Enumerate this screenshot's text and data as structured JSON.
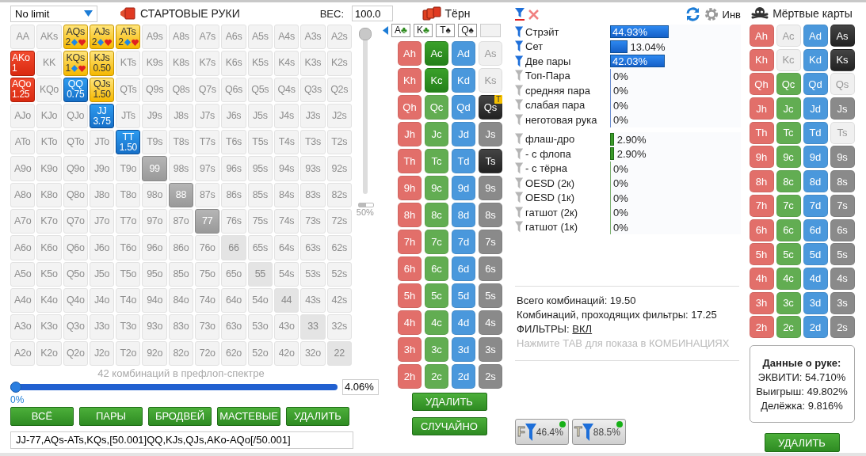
{
  "range_panel": {
    "game_dropdown": "No limit",
    "title": "СТАРТОВЫЕ РУКИ",
    "weight_label": "ВЕС:",
    "weight_value": "100.0",
    "grid": [
      [
        {
          "label": "AA",
          "kind": "none"
        },
        {
          "label": "AKs",
          "kind": "none"
        },
        {
          "label": "AQs",
          "kind": "gold-mixed",
          "weight": "2"
        },
        {
          "label": "AJs",
          "kind": "gold-mixed",
          "weight": "2"
        },
        {
          "label": "ATs",
          "kind": "gold-mixed",
          "weight": "2"
        },
        {
          "label": "A9s",
          "kind": "none"
        },
        {
          "label": "A8s",
          "kind": "none"
        },
        {
          "label": "A7s",
          "kind": "none"
        },
        {
          "label": "A6s",
          "kind": "none"
        },
        {
          "label": "A5s",
          "kind": "none"
        },
        {
          "label": "A4s",
          "kind": "none"
        },
        {
          "label": "A3s",
          "kind": "none"
        },
        {
          "label": "A2s",
          "kind": "none"
        }
      ],
      [
        {
          "label": "AKo",
          "kind": "red",
          "weight": "1"
        },
        {
          "label": "KK",
          "kind": "none"
        },
        {
          "label": "KQs",
          "kind": "gold-mixed",
          "weight": "1"
        },
        {
          "label": "KJs",
          "kind": "gold",
          "weight": "0.50"
        },
        {
          "label": "KTs",
          "kind": "none"
        },
        {
          "label": "K9s",
          "kind": "none"
        },
        {
          "label": "K8s",
          "kind": "none"
        },
        {
          "label": "K7s",
          "kind": "none"
        },
        {
          "label": "K6s",
          "kind": "none"
        },
        {
          "label": "K5s",
          "kind": "none"
        },
        {
          "label": "K4s",
          "kind": "none"
        },
        {
          "label": "K3s",
          "kind": "none"
        },
        {
          "label": "K2s",
          "kind": "none"
        }
      ],
      [
        {
          "label": "AQo",
          "kind": "red",
          "weight": "1.25"
        },
        {
          "label": "KQo",
          "kind": "none"
        },
        {
          "label": "QQ",
          "kind": "blue",
          "weight": "0.75"
        },
        {
          "label": "QJs",
          "kind": "gold",
          "weight": "1.50"
        },
        {
          "label": "QTs",
          "kind": "none"
        },
        {
          "label": "Q9s",
          "kind": "none"
        },
        {
          "label": "Q8s",
          "kind": "none"
        },
        {
          "label": "Q7s",
          "kind": "none"
        },
        {
          "label": "Q6s",
          "kind": "none"
        },
        {
          "label": "Q5s",
          "kind": "none"
        },
        {
          "label": "Q4s",
          "kind": "none"
        },
        {
          "label": "Q3s",
          "kind": "none"
        },
        {
          "label": "Q2s",
          "kind": "none"
        }
      ],
      [
        {
          "label": "AJo",
          "kind": "none"
        },
        {
          "label": "KJo",
          "kind": "none"
        },
        {
          "label": "QJo",
          "kind": "none"
        },
        {
          "label": "JJ",
          "kind": "blue",
          "weight": "3.75"
        },
        {
          "label": "JTs",
          "kind": "none"
        },
        {
          "label": "J9s",
          "kind": "none"
        },
        {
          "label": "J8s",
          "kind": "none"
        },
        {
          "label": "J7s",
          "kind": "none"
        },
        {
          "label": "J6s",
          "kind": "none"
        },
        {
          "label": "J5s",
          "kind": "none"
        },
        {
          "label": "J4s",
          "kind": "none"
        },
        {
          "label": "J3s",
          "kind": "none"
        },
        {
          "label": "J2s",
          "kind": "none"
        }
      ],
      [
        {
          "label": "ATo",
          "kind": "none"
        },
        {
          "label": "KTo",
          "kind": "none"
        },
        {
          "label": "QTo",
          "kind": "none"
        },
        {
          "label": "JTo",
          "kind": "none"
        },
        {
          "label": "TT",
          "kind": "blue",
          "weight": "1.50"
        },
        {
          "label": "T9s",
          "kind": "none"
        },
        {
          "label": "T8s",
          "kind": "none"
        },
        {
          "label": "T7s",
          "kind": "none"
        },
        {
          "label": "T6s",
          "kind": "none"
        },
        {
          "label": "T5s",
          "kind": "none"
        },
        {
          "label": "T4s",
          "kind": "none"
        },
        {
          "label": "T3s",
          "kind": "none"
        },
        {
          "label": "T2s",
          "kind": "none"
        }
      ],
      [
        {
          "label": "A9o",
          "kind": "none"
        },
        {
          "label": "K9o",
          "kind": "none"
        },
        {
          "label": "Q9o",
          "kind": "none"
        },
        {
          "label": "J9o",
          "kind": "none"
        },
        {
          "label": "T9o",
          "kind": "none"
        },
        {
          "label": "99",
          "kind": "dead"
        },
        {
          "label": "98s",
          "kind": "none"
        },
        {
          "label": "97s",
          "kind": "none"
        },
        {
          "label": "96s",
          "kind": "none"
        },
        {
          "label": "95s",
          "kind": "none"
        },
        {
          "label": "94s",
          "kind": "none"
        },
        {
          "label": "93s",
          "kind": "none"
        },
        {
          "label": "92s",
          "kind": "none"
        }
      ],
      [
        {
          "label": "A8o",
          "kind": "none"
        },
        {
          "label": "K8o",
          "kind": "none"
        },
        {
          "label": "Q8o",
          "kind": "none"
        },
        {
          "label": "J8o",
          "kind": "none"
        },
        {
          "label": "T8o",
          "kind": "none"
        },
        {
          "label": "98o",
          "kind": "none"
        },
        {
          "label": "88",
          "kind": "dead"
        },
        {
          "label": "87s",
          "kind": "none"
        },
        {
          "label": "86s",
          "kind": "none"
        },
        {
          "label": "85s",
          "kind": "none"
        },
        {
          "label": "84s",
          "kind": "none"
        },
        {
          "label": "83s",
          "kind": "none"
        },
        {
          "label": "82s",
          "kind": "none"
        }
      ],
      [
        {
          "label": "A7o",
          "kind": "none"
        },
        {
          "label": "K7o",
          "kind": "none"
        },
        {
          "label": "Q7o",
          "kind": "none"
        },
        {
          "label": "J7o",
          "kind": "none"
        },
        {
          "label": "T7o",
          "kind": "none"
        },
        {
          "label": "97o",
          "kind": "none"
        },
        {
          "label": "87o",
          "kind": "none"
        },
        {
          "label": "77",
          "kind": "dead"
        },
        {
          "label": "76s",
          "kind": "none"
        },
        {
          "label": "75s",
          "kind": "none"
        },
        {
          "label": "74s",
          "kind": "none"
        },
        {
          "label": "73s",
          "kind": "none"
        },
        {
          "label": "72s",
          "kind": "none"
        }
      ],
      [
        {
          "label": "A6o",
          "kind": "none"
        },
        {
          "label": "K6o",
          "kind": "none"
        },
        {
          "label": "Q6o",
          "kind": "none"
        },
        {
          "label": "J6o",
          "kind": "none"
        },
        {
          "label": "T6o",
          "kind": "none"
        },
        {
          "label": "96o",
          "kind": "none"
        },
        {
          "label": "86o",
          "kind": "none"
        },
        {
          "label": "76o",
          "kind": "none"
        },
        {
          "label": "66",
          "kind": "pair"
        },
        {
          "label": "65s",
          "kind": "none"
        },
        {
          "label": "64s",
          "kind": "none"
        },
        {
          "label": "63s",
          "kind": "none"
        },
        {
          "label": "62s",
          "kind": "none"
        }
      ],
      [
        {
          "label": "A5o",
          "kind": "none"
        },
        {
          "label": "K5o",
          "kind": "none"
        },
        {
          "label": "Q5o",
          "kind": "none"
        },
        {
          "label": "J5o",
          "kind": "none"
        },
        {
          "label": "T5o",
          "kind": "none"
        },
        {
          "label": "95o",
          "kind": "none"
        },
        {
          "label": "85o",
          "kind": "none"
        },
        {
          "label": "75o",
          "kind": "none"
        },
        {
          "label": "65o",
          "kind": "none"
        },
        {
          "label": "55",
          "kind": "pair"
        },
        {
          "label": "54s",
          "kind": "none"
        },
        {
          "label": "53s",
          "kind": "none"
        },
        {
          "label": "52s",
          "kind": "none"
        }
      ],
      [
        {
          "label": "A4o",
          "kind": "none"
        },
        {
          "label": "K4o",
          "kind": "none"
        },
        {
          "label": "Q4o",
          "kind": "none"
        },
        {
          "label": "J4o",
          "kind": "none"
        },
        {
          "label": "T4o",
          "kind": "none"
        },
        {
          "label": "94o",
          "kind": "none"
        },
        {
          "label": "84o",
          "kind": "none"
        },
        {
          "label": "74o",
          "kind": "none"
        },
        {
          "label": "64o",
          "kind": "none"
        },
        {
          "label": "54o",
          "kind": "none"
        },
        {
          "label": "44",
          "kind": "pair"
        },
        {
          "label": "43s",
          "kind": "none"
        },
        {
          "label": "42s",
          "kind": "none"
        }
      ],
      [
        {
          "label": "A3o",
          "kind": "none"
        },
        {
          "label": "K3o",
          "kind": "none"
        },
        {
          "label": "Q3o",
          "kind": "none"
        },
        {
          "label": "J3o",
          "kind": "none"
        },
        {
          "label": "T3o",
          "kind": "none"
        },
        {
          "label": "93o",
          "kind": "none"
        },
        {
          "label": "83o",
          "kind": "none"
        },
        {
          "label": "73o",
          "kind": "none"
        },
        {
          "label": "63o",
          "kind": "none"
        },
        {
          "label": "53o",
          "kind": "none"
        },
        {
          "label": "43o",
          "kind": "none"
        },
        {
          "label": "33",
          "kind": "pair"
        },
        {
          "label": "32s",
          "kind": "none"
        }
      ],
      [
        {
          "label": "A2o",
          "kind": "none"
        },
        {
          "label": "K2o",
          "kind": "none"
        },
        {
          "label": "Q2o",
          "kind": "none"
        },
        {
          "label": "J2o",
          "kind": "none"
        },
        {
          "label": "T2o",
          "kind": "none"
        },
        {
          "label": "92o",
          "kind": "none"
        },
        {
          "label": "82o",
          "kind": "none"
        },
        {
          "label": "72o",
          "kind": "none"
        },
        {
          "label": "62o",
          "kind": "none"
        },
        {
          "label": "52o",
          "kind": "none"
        },
        {
          "label": "42o",
          "kind": "none"
        },
        {
          "label": "32o",
          "kind": "none"
        },
        {
          "label": "22",
          "kind": "pair"
        }
      ]
    ],
    "weight_slider": {
      "level": 1
    },
    "mini_meter": {
      "level": 0.5,
      "reading": "50%"
    },
    "caption": "42 комбинаций в префлоп-спектре",
    "range_slider": {
      "level": 0,
      "reading": "0%",
      "value": "4.06%"
    },
    "buttons": [
      "ВСЁ",
      "ПАРЫ",
      "БРОДВЕЙ",
      "МАСТЕВЫЕ",
      "УДАЛИТЬ"
    ],
    "range_text": "JJ-77,AQs-ATs,KQs,[50.001]QQ,KJs,QJs,AKo-AQo[/50.001]"
  },
  "turn_panel": {
    "title": "Тёрн",
    "board": [
      {
        "rank": "A",
        "suit": "♣",
        "color": "#2e8b1e"
      },
      {
        "rank": "K",
        "suit": "♣",
        "color": "#2e8b1e"
      },
      {
        "rank": "T",
        "suit": "♠",
        "color": "#222222"
      },
      {
        "rank": "Q",
        "suit": "♠",
        "color": "#222222"
      }
    ],
    "cards": [
      [
        {
          "label": "Ah",
          "kind": "normal"
        },
        {
          "label": "Ac",
          "kind": "selected"
        },
        {
          "label": "Ad",
          "kind": "normal"
        },
        {
          "label": "As",
          "kind": "blocked"
        }
      ],
      [
        {
          "label": "Kh",
          "kind": "normal"
        },
        {
          "label": "Kc",
          "kind": "selected"
        },
        {
          "label": "Kd",
          "kind": "normal"
        },
        {
          "label": "Ks",
          "kind": "blocked"
        }
      ],
      [
        {
          "label": "Qh",
          "kind": "normal"
        },
        {
          "label": "Qc",
          "kind": "normal"
        },
        {
          "label": "Qd",
          "kind": "normal"
        },
        {
          "label": "Qs",
          "kind": "board",
          "badge": "T"
        }
      ],
      [
        {
          "label": "Jh",
          "kind": "normal"
        },
        {
          "label": "Jc",
          "kind": "normal"
        },
        {
          "label": "Jd",
          "kind": "normal"
        },
        {
          "label": "Js",
          "kind": "normal"
        }
      ],
      [
        {
          "label": "Th",
          "kind": "normal"
        },
        {
          "label": "Tc",
          "kind": "normal"
        },
        {
          "label": "Td",
          "kind": "normal"
        },
        {
          "label": "Ts",
          "kind": "board"
        }
      ],
      [
        {
          "label": "9h",
          "kind": "normal"
        },
        {
          "label": "9c",
          "kind": "normal"
        },
        {
          "label": "9d",
          "kind": "normal"
        },
        {
          "label": "9s",
          "kind": "normal"
        }
      ],
      [
        {
          "label": "8h",
          "kind": "normal"
        },
        {
          "label": "8c",
          "kind": "normal"
        },
        {
          "label": "8d",
          "kind": "normal"
        },
        {
          "label": "8s",
          "kind": "normal"
        }
      ],
      [
        {
          "label": "7h",
          "kind": "normal"
        },
        {
          "label": "7c",
          "kind": "normal"
        },
        {
          "label": "7d",
          "kind": "normal"
        },
        {
          "label": "7s",
          "kind": "normal"
        }
      ],
      [
        {
          "label": "6h",
          "kind": "normal"
        },
        {
          "label": "6c",
          "kind": "normal"
        },
        {
          "label": "6d",
          "kind": "normal"
        },
        {
          "label": "6s",
          "kind": "normal"
        }
      ],
      [
        {
          "label": "5h",
          "kind": "normal"
        },
        {
          "label": "5c",
          "kind": "normal"
        },
        {
          "label": "5d",
          "kind": "normal"
        },
        {
          "label": "5s",
          "kind": "normal"
        }
      ],
      [
        {
          "label": "4h",
          "kind": "normal"
        },
        {
          "label": "4c",
          "kind": "normal"
        },
        {
          "label": "4d",
          "kind": "normal"
        },
        {
          "label": "4s",
          "kind": "normal"
        }
      ],
      [
        {
          "label": "3h",
          "kind": "normal"
        },
        {
          "label": "3c",
          "kind": "normal"
        },
        {
          "label": "3d",
          "kind": "normal"
        },
        {
          "label": "3s",
          "kind": "normal"
        }
      ],
      [
        {
          "label": "2h",
          "kind": "normal"
        },
        {
          "label": "2c",
          "kind": "normal"
        },
        {
          "label": "2d",
          "kind": "normal"
        },
        {
          "label": "2s",
          "kind": "normal"
        }
      ]
    ],
    "buttons": [
      "УДАЛИТЬ",
      "СЛУЧАЙНО"
    ]
  },
  "filters_panel": {
    "invert_label": "Инв",
    "made": [
      {
        "label": "Стрэйт",
        "active": true,
        "level": 0.4493,
        "reading": "44.93%"
      },
      {
        "label": "Сет",
        "active": true,
        "level": 0.1304,
        "reading": "13.04%"
      },
      {
        "label": "Две пары",
        "active": true,
        "level": 0.4203,
        "reading": "42.03%"
      },
      {
        "label": "Топ-Пара",
        "active": false,
        "level": 0,
        "reading": "0%"
      },
      {
        "label": "средняя пара",
        "active": false,
        "level": 0,
        "reading": "0%"
      },
      {
        "label": "слабая пара",
        "active": false,
        "level": 0,
        "reading": "0%"
      },
      {
        "label": "неготовая рука",
        "active": false,
        "level": 0,
        "reading": "0%"
      }
    ],
    "draws": [
      {
        "label": "флаш-дро",
        "active": false,
        "level": 0.029,
        "reading": "2.90%"
      },
      {
        "label": "- с флопа",
        "active": false,
        "level": 0.029,
        "reading": "2.90%"
      },
      {
        "label": "- с тёрна",
        "active": false,
        "level": 0,
        "reading": "0%"
      },
      {
        "label": "OESD (2к)",
        "active": false,
        "level": 0,
        "reading": "0%"
      },
      {
        "label": "OESD (1к)",
        "active": false,
        "level": 0,
        "reading": "0%"
      },
      {
        "label": "гатшот (2к)",
        "active": false,
        "level": 0,
        "reading": "0%"
      },
      {
        "label": "гатшот (1к)",
        "active": false,
        "level": 0,
        "reading": "0%"
      }
    ],
    "total": "Всего комбинаций: 19.50",
    "passing": "Комбинаций, проходящих фильтры: 17.25",
    "filters_label": "ФИЛЬТРЫ:",
    "filters_link": "ВКЛ",
    "hint": "Нажмите ТАВ для показа в КОМБИНАЦИЯХ",
    "presets": [
      {
        "letter": "F",
        "reading": "46.4%",
        "on": true
      },
      {
        "letter": "T",
        "reading": "88.5%",
        "on": true
      }
    ]
  },
  "dead_panel": {
    "title": "Мёртвые карты",
    "cards": [
      [
        {
          "label": "Ah",
          "kind": "normal"
        },
        {
          "label": "Ac",
          "kind": "blocked"
        },
        {
          "label": "Ad",
          "kind": "normal"
        },
        {
          "label": "As",
          "kind": "dead"
        }
      ],
      [
        {
          "label": "Kh",
          "kind": "normal"
        },
        {
          "label": "Kc",
          "kind": "blocked"
        },
        {
          "label": "Kd",
          "kind": "normal"
        },
        {
          "label": "Ks",
          "kind": "dead"
        }
      ],
      [
        {
          "label": "Qh",
          "kind": "normal"
        },
        {
          "label": "Qc",
          "kind": "normal"
        },
        {
          "label": "Qd",
          "kind": "normal"
        },
        {
          "label": "Qs",
          "kind": "blocked"
        }
      ],
      [
        {
          "label": "Jh",
          "kind": "normal"
        },
        {
          "label": "Jc",
          "kind": "normal"
        },
        {
          "label": "Jd",
          "kind": "normal"
        },
        {
          "label": "Js",
          "kind": "normal"
        }
      ],
      [
        {
          "label": "Th",
          "kind": "normal"
        },
        {
          "label": "Tc",
          "kind": "normal"
        },
        {
          "label": "Td",
          "kind": "normal"
        },
        {
          "label": "Ts",
          "kind": "blocked"
        }
      ],
      [
        {
          "label": "9h",
          "kind": "normal"
        },
        {
          "label": "9c",
          "kind": "normal"
        },
        {
          "label": "9d",
          "kind": "normal"
        },
        {
          "label": "9s",
          "kind": "normal"
        }
      ],
      [
        {
          "label": "8h",
          "kind": "normal"
        },
        {
          "label": "8c",
          "kind": "normal"
        },
        {
          "label": "8d",
          "kind": "normal"
        },
        {
          "label": "8s",
          "kind": "normal"
        }
      ],
      [
        {
          "label": "7h",
          "kind": "normal"
        },
        {
          "label": "7c",
          "kind": "normal"
        },
        {
          "label": "7d",
          "kind": "normal"
        },
        {
          "label": "7s",
          "kind": "normal"
        }
      ],
      [
        {
          "label": "6h",
          "kind": "normal"
        },
        {
          "label": "6c",
          "kind": "normal"
        },
        {
          "label": "6d",
          "kind": "normal"
        },
        {
          "label": "6s",
          "kind": "normal"
        }
      ],
      [
        {
          "label": "5h",
          "kind": "normal"
        },
        {
          "label": "5c",
          "kind": "normal"
        },
        {
          "label": "5d",
          "kind": "normal"
        },
        {
          "label": "5s",
          "kind": "normal"
        }
      ],
      [
        {
          "label": "4h",
          "kind": "normal"
        },
        {
          "label": "4c",
          "kind": "normal"
        },
        {
          "label": "4d",
          "kind": "normal"
        },
        {
          "label": "4s",
          "kind": "normal"
        }
      ],
      [
        {
          "label": "3h",
          "kind": "normal"
        },
        {
          "label": "3c",
          "kind": "normal"
        },
        {
          "label": "3d",
          "kind": "normal"
        },
        {
          "label": "3s",
          "kind": "normal"
        }
      ],
      [
        {
          "label": "2h",
          "kind": "normal"
        },
        {
          "label": "2c",
          "kind": "normal"
        },
        {
          "label": "2d",
          "kind": "normal"
        },
        {
          "label": "2s",
          "kind": "normal"
        }
      ]
    ],
    "hand_data": {
      "title": "Данные о руке:",
      "lines": [
        "ЭКВИТИ: 54.710%",
        "Выигрыш: 49.802%",
        "Делёжка: 9.816%"
      ]
    },
    "button": "УДАЛИТЬ"
  }
}
